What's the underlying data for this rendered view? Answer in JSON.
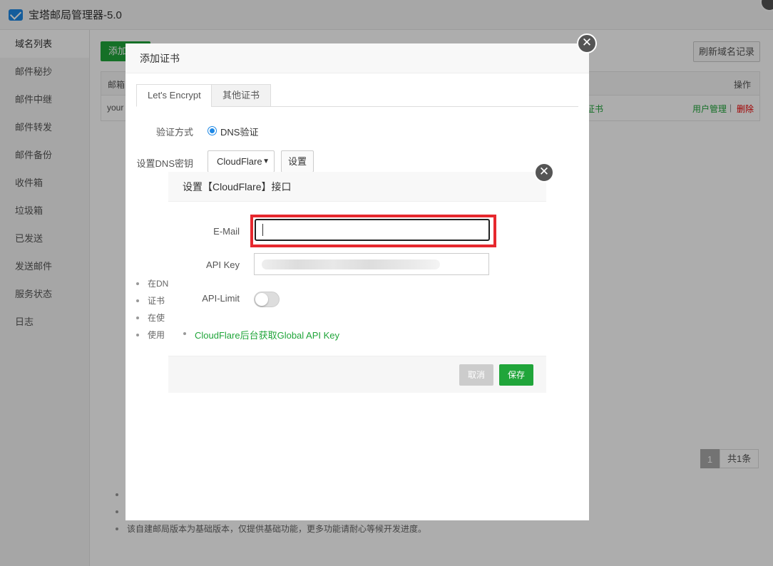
{
  "app": {
    "title": "宝塔邮局管理器-5.0"
  },
  "sidebar": {
    "items": [
      {
        "label": "域名列表"
      },
      {
        "label": "邮件秘抄"
      },
      {
        "label": "邮件中继"
      },
      {
        "label": "邮件转发"
      },
      {
        "label": "邮件备份"
      },
      {
        "label": "收件箱"
      },
      {
        "label": "垃圾箱"
      },
      {
        "label": "已发送"
      },
      {
        "label": "发送邮件"
      },
      {
        "label": "服务状态"
      },
      {
        "label": "日志"
      }
    ]
  },
  "main": {
    "add_button": "添加",
    "refresh_button": "刷新域名记录",
    "table": {
      "col_first": "邮箱",
      "col_action": "操作",
      "row_first": "your",
      "row_cert_fragment": "证书",
      "row_user_manage": "用户管理",
      "row_separator": "|",
      "row_delete": "删除"
    },
    "pager": {
      "page": "1",
      "total": "共1条"
    },
    "notes": [
      "",
      "",
      "该自建邮局版本为基础版本，仅提供基础功能，更多功能请耐心等候开发进度。"
    ]
  },
  "cert_dialog": {
    "title": "添加证书",
    "tabs": [
      "Let's Encrypt",
      "其他证书"
    ],
    "verify_label": "验证方式",
    "verify_option": "DNS验证",
    "dns_key_label": "设置DNS密钥",
    "dns_provider": "CloudFlare",
    "settings_button": "设置",
    "notes": [
      "在DN",
      "证书",
      "在使",
      "使用"
    ]
  },
  "cf_dialog": {
    "title": "设置【CloudFlare】接口",
    "email_label": "E-Mail",
    "email_value": "",
    "api_key_label": "API Key",
    "api_limit_label": "API-Limit",
    "api_limit_on": false,
    "help_link": "CloudFlare后台获取Global API Key",
    "cancel_button": "取消",
    "save_button": "保存"
  },
  "colors": {
    "brand_green": "#20a53a",
    "highlight_red": "#e6282e",
    "danger_red": "#ee0000"
  },
  "icons": {
    "app": "mail-icon",
    "close": "close-icon",
    "select": "chevron-down-icon"
  }
}
